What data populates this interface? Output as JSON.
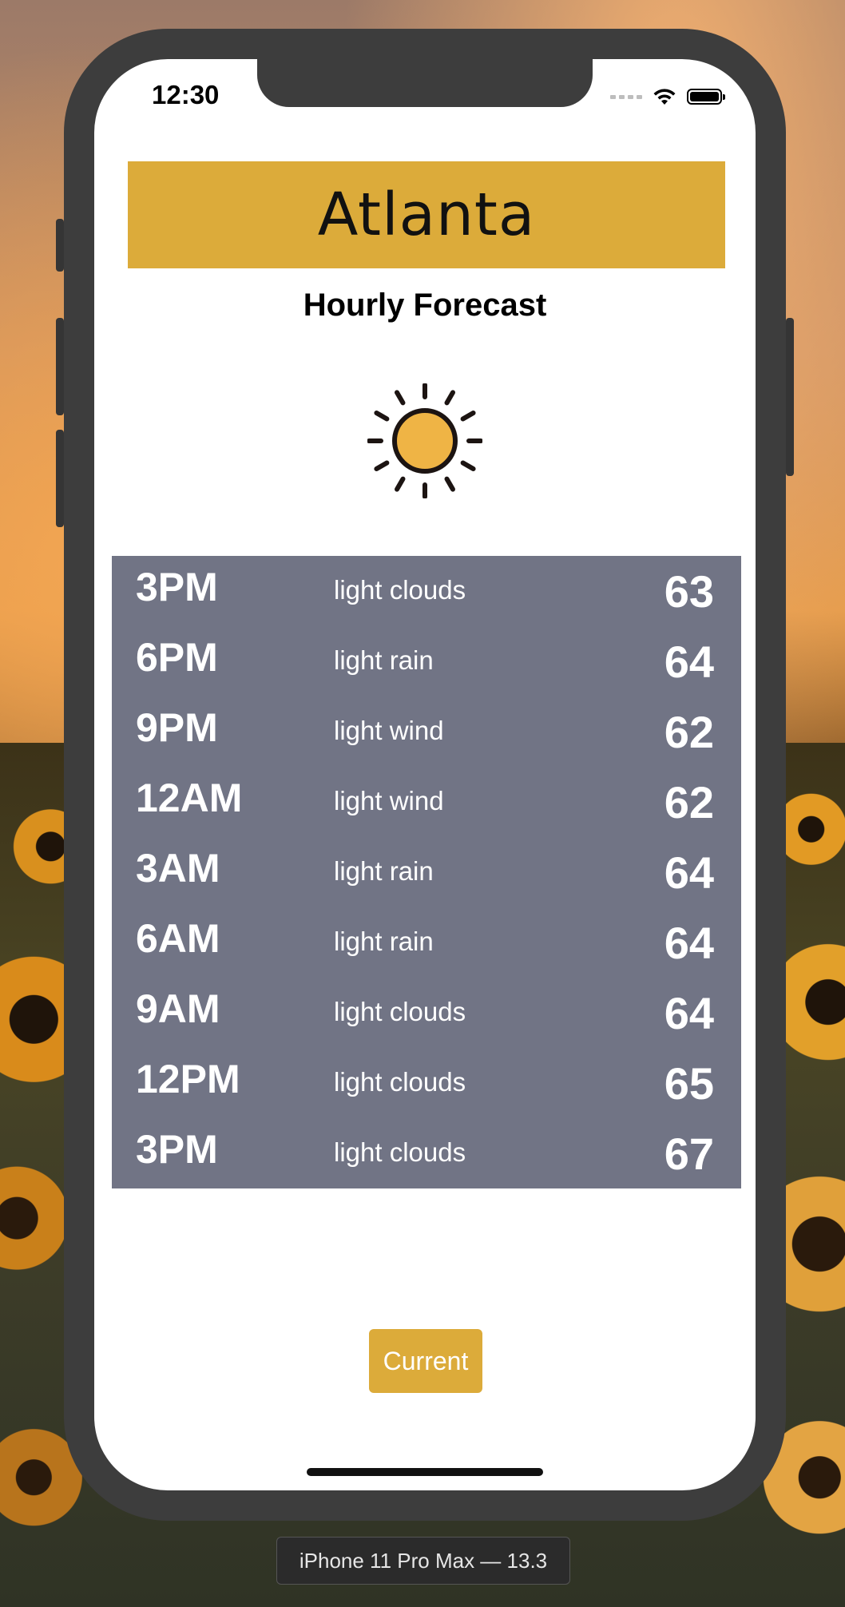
{
  "status_bar": {
    "time": "12:30",
    "icons": [
      "cellular-dots-icon",
      "wifi-icon",
      "battery-icon"
    ]
  },
  "header": {
    "city": "Atlanta",
    "subtitle": "Hourly Forecast",
    "weather_icon": "sun-icon"
  },
  "forecast": {
    "rows": [
      {
        "time": "3PM",
        "desc": "light clouds",
        "temp": "63"
      },
      {
        "time": "6PM",
        "desc": "light rain",
        "temp": "64"
      },
      {
        "time": "9PM",
        "desc": "light wind",
        "temp": "62"
      },
      {
        "time": "12AM",
        "desc": "light wind",
        "temp": "62"
      },
      {
        "time": "3AM",
        "desc": "light rain",
        "temp": "64"
      },
      {
        "time": "6AM",
        "desc": "light rain",
        "temp": "64"
      },
      {
        "time": "9AM",
        "desc": "light clouds",
        "temp": "64"
      },
      {
        "time": "12PM",
        "desc": "light clouds",
        "temp": "65"
      },
      {
        "time": "3PM",
        "desc": "light clouds",
        "temp": "67"
      }
    ]
  },
  "actions": {
    "current_label": "Current"
  },
  "simulator": {
    "device_label": "iPhone 11 Pro Max — 13.3"
  },
  "colors": {
    "accent": "#dcab3a",
    "forecast_bg": "#717485",
    "sun_fill": "#efb445",
    "sun_stroke": "#1c1412"
  }
}
